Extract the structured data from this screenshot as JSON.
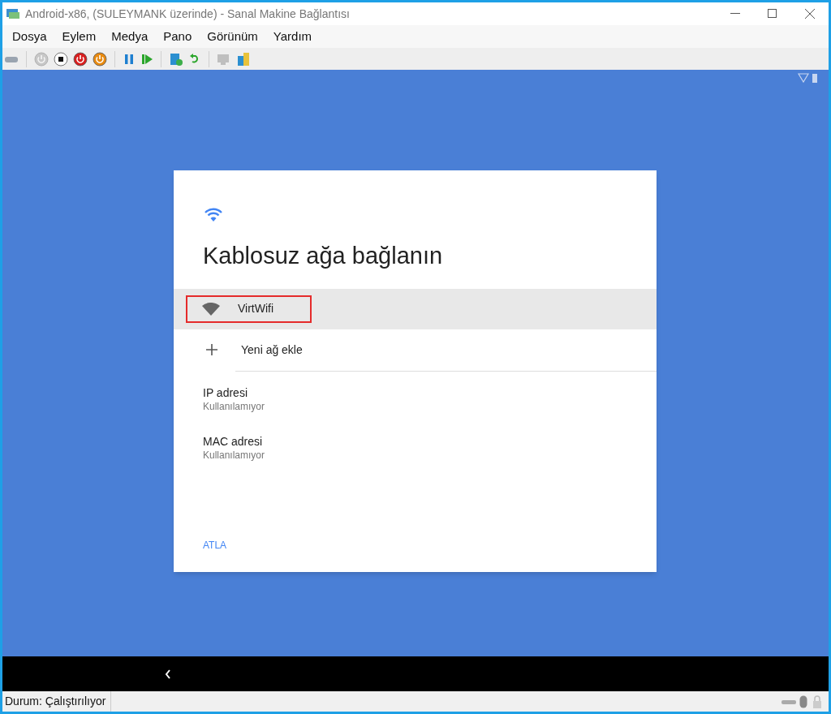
{
  "window": {
    "title": "Android-x86, (SULEYMANK üzerinde) - Sanal Makine Bağlantısı"
  },
  "menu": [
    "Dosya",
    "Eylem",
    "Medya",
    "Pano",
    "Görünüm",
    "Yardım"
  ],
  "toolbar": [
    {
      "kind": "ctrl-alt-del",
      "disabled": false
    },
    {
      "kind": "sep"
    },
    {
      "kind": "start",
      "disabled": true
    },
    {
      "kind": "turn-off",
      "disabled": false
    },
    {
      "kind": "shut-down",
      "disabled": false
    },
    {
      "kind": "save",
      "disabled": false
    },
    {
      "kind": "sep"
    },
    {
      "kind": "pause",
      "disabled": false
    },
    {
      "kind": "resume",
      "disabled": false
    },
    {
      "kind": "sep"
    },
    {
      "kind": "checkpoint",
      "disabled": false
    },
    {
      "kind": "revert",
      "disabled": false
    },
    {
      "kind": "sep"
    },
    {
      "kind": "enhanced",
      "disabled": true
    },
    {
      "kind": "share",
      "disabled": false
    }
  ],
  "dialog": {
    "title": "Kablosuz ağa bağlanın",
    "networks": [
      {
        "name": "VirtWifi",
        "selected": true,
        "highlighted": true
      }
    ],
    "add_network": "Yeni ağ ekle",
    "info": [
      {
        "label": "IP adresi",
        "value": "Kullanılamıyor"
      },
      {
        "label": "MAC adresi",
        "value": "Kullanılamıyor"
      }
    ],
    "skip": "ATLA"
  },
  "status_bar": {
    "status": "Durum: Çalıştırılıyor"
  }
}
